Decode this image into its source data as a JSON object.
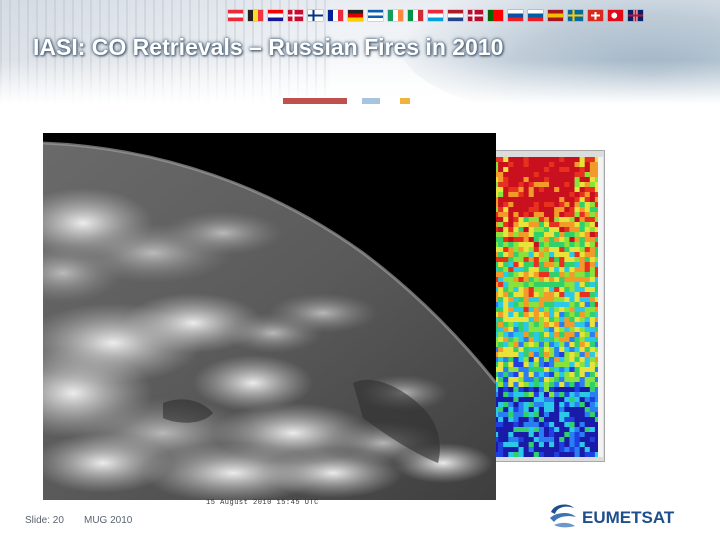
{
  "slide": {
    "title": "IASI: CO Retrievals – Russian Fires in 2010",
    "footer_slide": "Slide: 20",
    "footer_event": "MUG 2010",
    "logo_text": "EUMETSAT",
    "image_caption": "15 August 2010 15:45 UTC"
  },
  "header": {
    "flags": [
      {
        "name": "flag-austria",
        "colors": [
          "#ed2939",
          "#ffffff",
          "#ed2939"
        ],
        "dir": "h"
      },
      {
        "name": "flag-belgium",
        "colors": [
          "#222222",
          "#fdda24",
          "#ef3340"
        ],
        "dir": "v"
      },
      {
        "name": "flag-croatia",
        "colors": [
          "#ff0000",
          "#ffffff",
          "#171796"
        ],
        "dir": "h"
      },
      {
        "name": "flag-denmark",
        "colors": [
          "#c60c30",
          "#ffffff"
        ],
        "dir": "cross"
      },
      {
        "name": "flag-finland",
        "colors": [
          "#ffffff",
          "#003580"
        ],
        "dir": "cross"
      },
      {
        "name": "flag-france",
        "colors": [
          "#002395",
          "#ffffff",
          "#ed2939"
        ],
        "dir": "v"
      },
      {
        "name": "flag-germany",
        "colors": [
          "#222222",
          "#dd0000",
          "#ffce00"
        ],
        "dir": "h"
      },
      {
        "name": "flag-greece",
        "colors": [
          "#0d5eaf",
          "#ffffff",
          "#0d5eaf",
          "#ffffff"
        ],
        "dir": "h"
      },
      {
        "name": "flag-ireland",
        "colors": [
          "#169b62",
          "#ffffff",
          "#ff883e"
        ],
        "dir": "v"
      },
      {
        "name": "flag-italy",
        "colors": [
          "#009246",
          "#ffffff",
          "#ce2b37"
        ],
        "dir": "v"
      },
      {
        "name": "flag-luxembourg",
        "colors": [
          "#ed2939",
          "#ffffff",
          "#00a1de"
        ],
        "dir": "h"
      },
      {
        "name": "flag-netherlands",
        "colors": [
          "#ae1c28",
          "#ffffff",
          "#21468b"
        ],
        "dir": "h"
      },
      {
        "name": "flag-norway",
        "colors": [
          "#ba0c2f",
          "#ffffff"
        ],
        "dir": "cross"
      },
      {
        "name": "flag-portugal",
        "colors": [
          "#006600",
          "#ff0000",
          "#ff0000"
        ],
        "dir": "v"
      },
      {
        "name": "flag-slovakia",
        "colors": [
          "#ffffff",
          "#0b4ea2",
          "#ee1c25"
        ],
        "dir": "h"
      },
      {
        "name": "flag-slovenia",
        "colors": [
          "#ffffff",
          "#005da4",
          "#ed1c24"
        ],
        "dir": "h"
      },
      {
        "name": "flag-spain",
        "colors": [
          "#aa151b",
          "#f1bf00",
          "#aa151b"
        ],
        "dir": "h"
      },
      {
        "name": "flag-sweden",
        "colors": [
          "#006aa7",
          "#fecc00"
        ],
        "dir": "cross"
      },
      {
        "name": "flag-switzerland",
        "colors": [
          "#da291c",
          "#ffffff"
        ],
        "dir": "swiss"
      },
      {
        "name": "flag-turkey",
        "colors": [
          "#e30a17",
          "#ffffff"
        ],
        "dir": "crescent"
      },
      {
        "name": "flag-uk",
        "colors": [
          "#012169",
          "#c8102e",
          "#ffffff"
        ],
        "dir": "uk"
      }
    ],
    "accent_colors": [
      "#c0504d",
      "#a9c4e0",
      "#f0b43c"
    ]
  },
  "theme": {
    "brand_blue": "#1f4e8c",
    "footer_text": "#5b6470"
  }
}
